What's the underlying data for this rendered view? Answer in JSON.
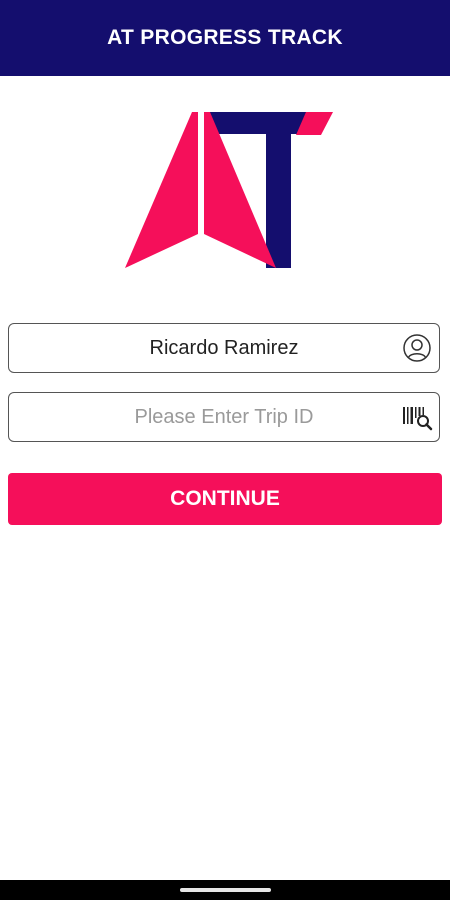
{
  "app_bar": {
    "title": "AT PROGRESS TRACK",
    "background": "#140e6e"
  },
  "logo": {
    "alt": "AT",
    "primary_color": "#f50f5a",
    "secondary_color": "#140e6e"
  },
  "form": {
    "name_field": {
      "value": "Ricardo Ramirez",
      "icon": "user-icon"
    },
    "trip_field": {
      "value": "",
      "placeholder": "Please Enter Trip ID",
      "icon": "barcode-scan-icon"
    },
    "continue_label": "CONTINUE",
    "accent": "#f50f5a"
  }
}
